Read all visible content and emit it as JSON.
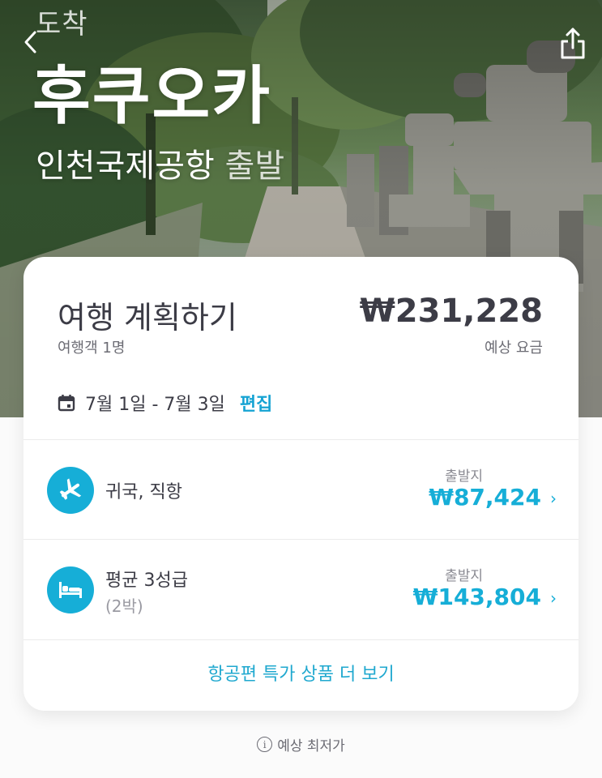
{
  "header": {
    "arrival_label": "도착",
    "city": "후쿠오카",
    "origin": "인천국제공항",
    "depart_word": "출발"
  },
  "plan": {
    "title": "여행 계획하기",
    "travelers": "여행객 1명",
    "total_price": "₩231,228",
    "price_caption": "예상 요금",
    "dates": "7월 1일 - 7월 3일",
    "edit_label": "편집"
  },
  "items": [
    {
      "icon": "airplane-icon",
      "label": "귀국, 직항",
      "sub": "",
      "caption": "출발지",
      "price": "₩87,424"
    },
    {
      "icon": "bed-icon",
      "label": "평균 3성급",
      "sub": "(2박)",
      "caption": "출발지",
      "price": "₩143,804"
    }
  ],
  "more_deals": "항공편 특가 상품 더 보기",
  "footnote": "예상 최저가",
  "colors": {
    "accent": "#16aed7",
    "text": "#3c3c46",
    "muted": "#6c6c74"
  }
}
